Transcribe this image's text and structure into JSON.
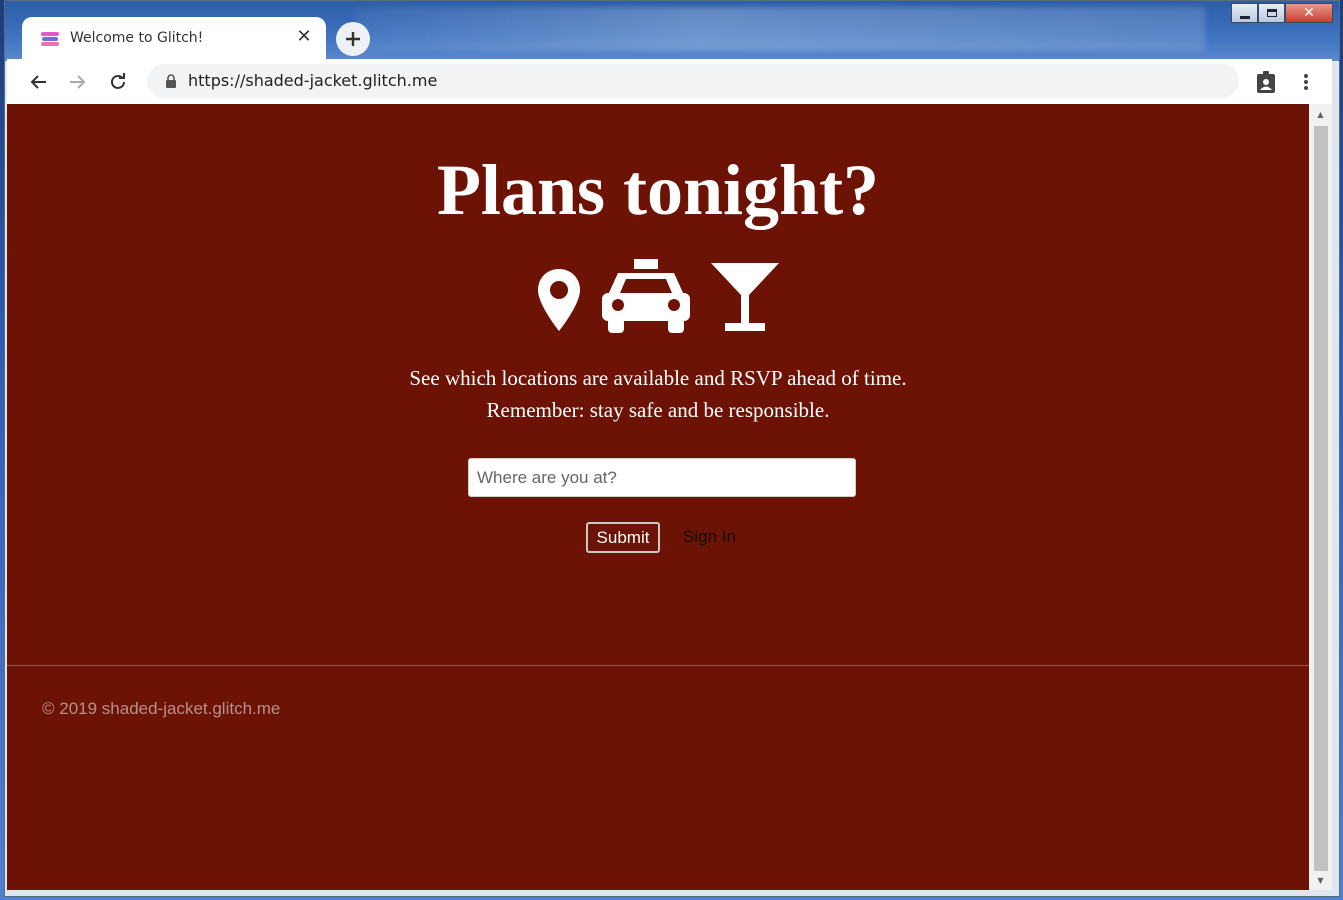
{
  "browser": {
    "tab": {
      "title": "Welcome to Glitch!",
      "close_glyph": "✕",
      "favicon": "glitch-favicon-icon"
    },
    "new_tab_glyph": "+",
    "url": "https://shaded-jacket.glitch.me",
    "window_controls": {
      "close_glyph": "✕"
    }
  },
  "page": {
    "title": "Plans tonight?",
    "icons": [
      "map-marker-icon",
      "taxi-icon",
      "cocktail-glass-icon"
    ],
    "tagline_line1": "See which locations are available and RSVP ahead of time.",
    "tagline_line2": "Remember: stay safe and be responsible.",
    "search": {
      "placeholder": "Where are you at?",
      "value": ""
    },
    "submit_label": "Submit",
    "signin_label": "Sign In",
    "footer": "© 2019 shaded-jacket.glitch.me"
  },
  "colors": {
    "page_background": "#6d1306",
    "text": "#ffffff",
    "footer_text": "#b8908a"
  }
}
